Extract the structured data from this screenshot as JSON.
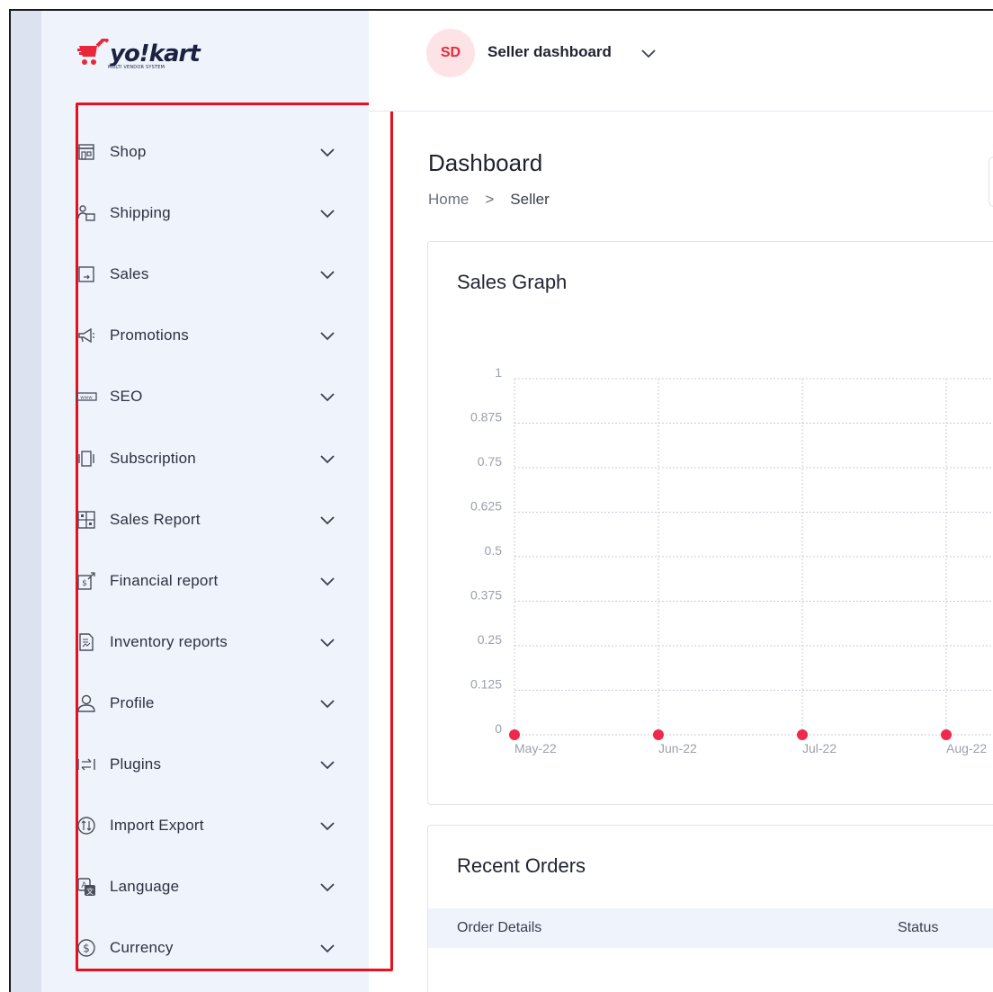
{
  "brand": {
    "name": "yo!kart",
    "tagline": "MULTI VENDOR SYSTEM",
    "accent": "#e8283a"
  },
  "sidebar": {
    "items": [
      {
        "label": "Shop",
        "icon": "store-icon"
      },
      {
        "label": "Shipping",
        "icon": "shipping-icon"
      },
      {
        "label": "Sales",
        "icon": "sales-icon"
      },
      {
        "label": "Promotions",
        "icon": "megaphone-icon"
      },
      {
        "label": "SEO",
        "icon": "www-icon"
      },
      {
        "label": "Subscription",
        "icon": "subscription-icon"
      },
      {
        "label": "Sales Report",
        "icon": "report-grid-icon"
      },
      {
        "label": "Financial report",
        "icon": "financial-report-icon"
      },
      {
        "label": "Inventory reports",
        "icon": "inventory-report-icon"
      },
      {
        "label": "Profile",
        "icon": "user-icon"
      },
      {
        "label": "Plugins",
        "icon": "plugins-icon"
      },
      {
        "label": "Import Export",
        "icon": "import-export-icon"
      },
      {
        "label": "Language",
        "icon": "language-icon"
      },
      {
        "label": "Currency",
        "icon": "currency-icon"
      }
    ]
  },
  "header": {
    "avatar_initials": "SD",
    "dashboard_selector": "Seller dashboard"
  },
  "page": {
    "title": "Dashboard",
    "breadcrumb": {
      "home": "Home",
      "separator": ">",
      "current": "Seller"
    }
  },
  "sales_graph": {
    "title": "Sales Graph"
  },
  "chart_data": {
    "type": "line",
    "title": "Sales Graph",
    "categories": [
      "May-22",
      "Jun-22",
      "Jul-22",
      "Aug-22"
    ],
    "series": [
      {
        "values": [
          0,
          0,
          0,
          0
        ],
        "color": "#f0284a"
      }
    ],
    "y_ticks": [
      "1",
      "0.875",
      "0.75",
      "0.625",
      "0.5",
      "0.375",
      "0.25",
      "0.125",
      "0"
    ],
    "ylim": [
      0,
      1
    ],
    "grid": true
  },
  "recent_orders": {
    "title": "Recent Orders",
    "columns": [
      "Order Details",
      "Status"
    ]
  }
}
